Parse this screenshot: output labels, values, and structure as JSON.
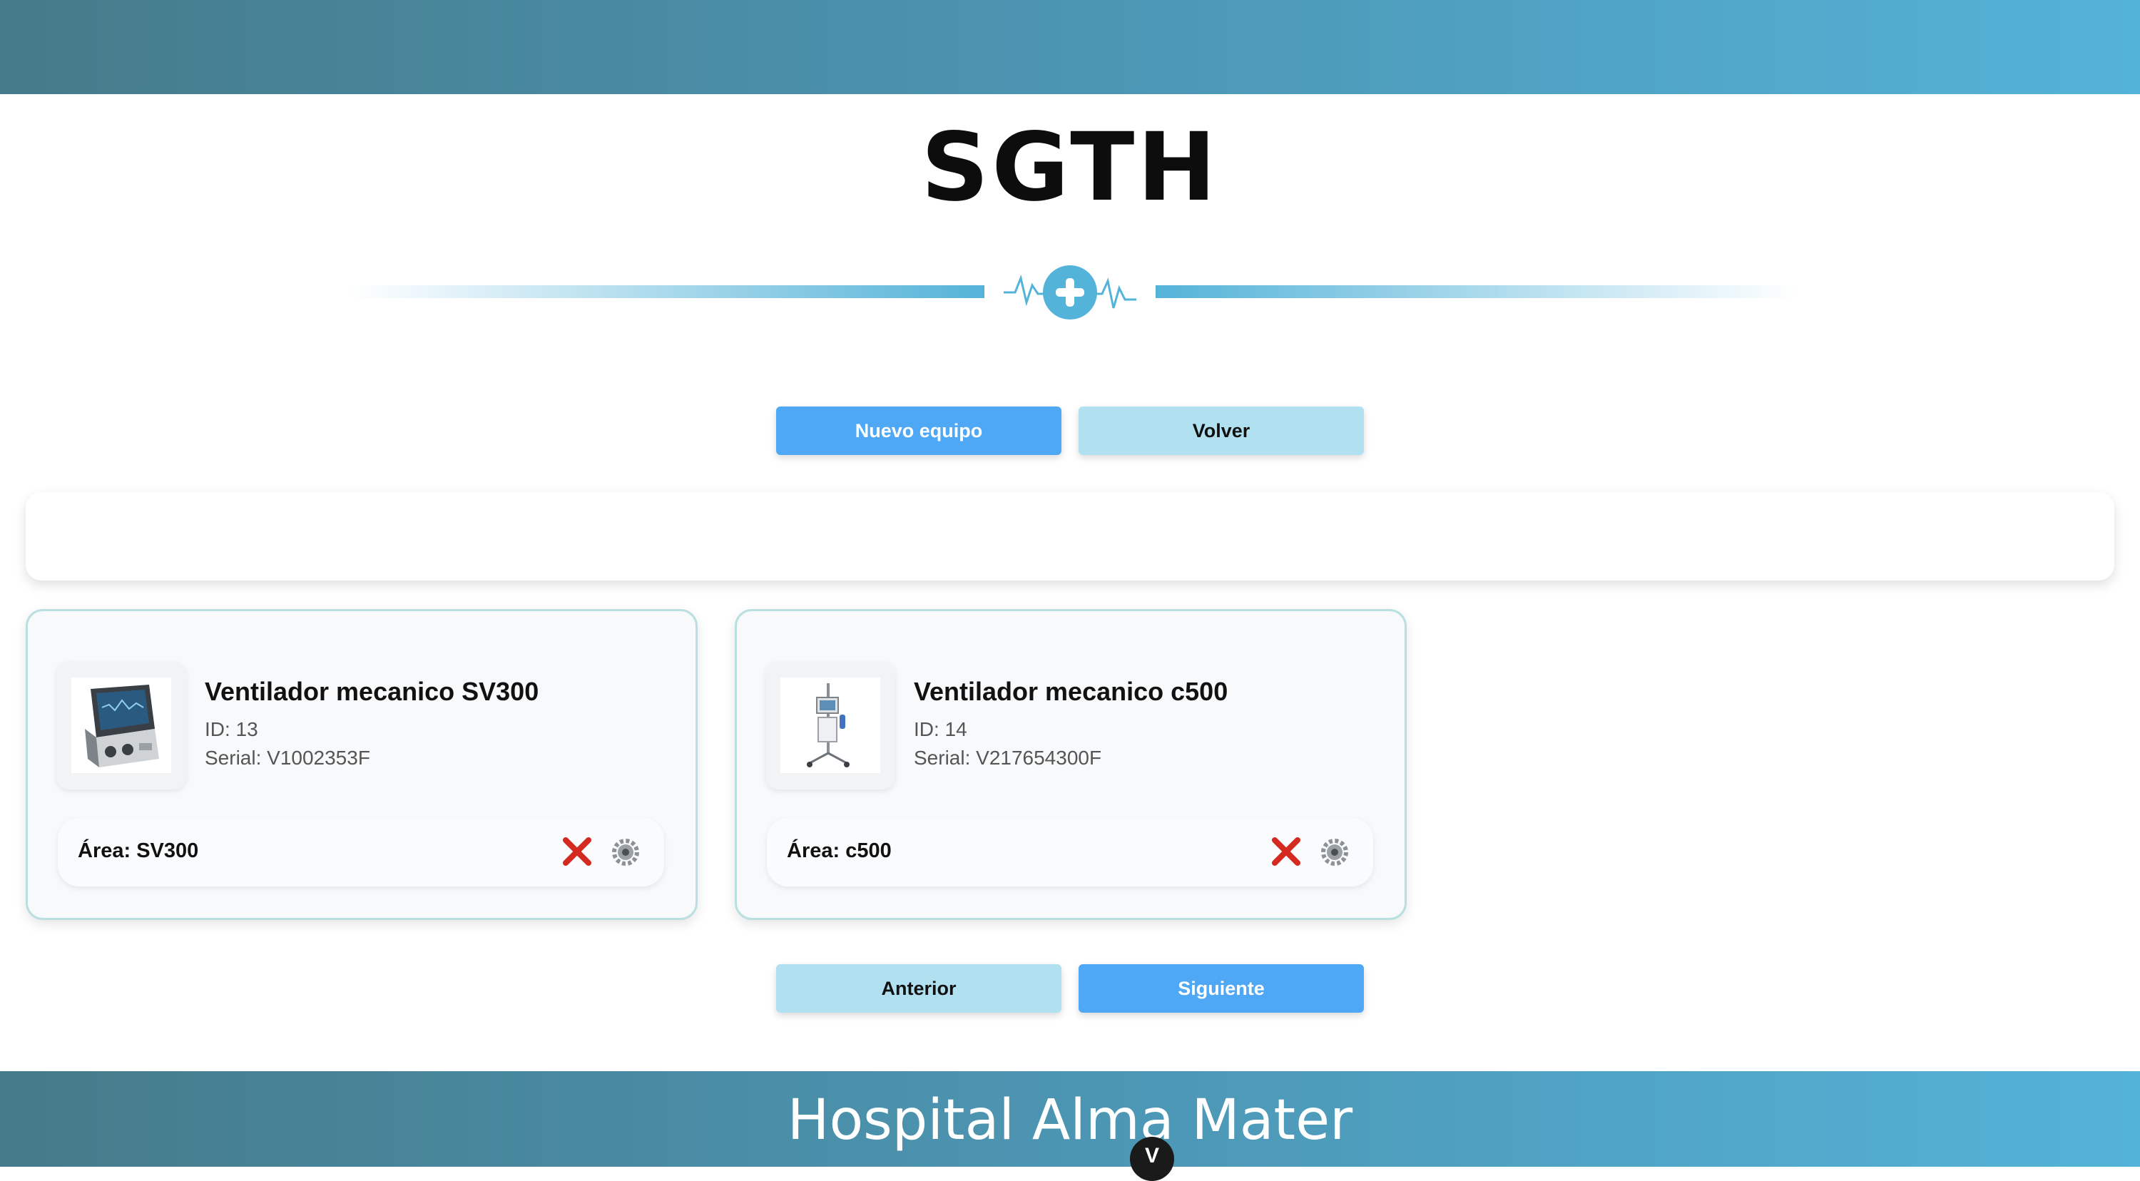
{
  "header": {
    "app_title": "SGTH"
  },
  "toolbar": {
    "new_label": "Nuevo equipo",
    "back_label": "Volver"
  },
  "equipment": [
    {
      "name": "Ventilador mecanico SV300",
      "id": "ID: 13",
      "serial": "Serial: V1002353F",
      "area": "Área: SV300"
    },
    {
      "name": "Ventilador mecanico c500",
      "id": "ID: 14",
      "serial": "Serial: V217654300F",
      "area": "Área: c500"
    }
  ],
  "pagination": {
    "prev_label": "Anterior",
    "next_label": "Siguiente"
  },
  "footer": {
    "hospital_name": "Hospital Alma Mater",
    "badge": "V"
  },
  "colors": {
    "header_gradient": [
      "#457b8a",
      "#54b3d8"
    ],
    "primary_button": "#4fa8f5",
    "secondary_button": "#b1e1f0",
    "delete": "#d42a1f",
    "accent": "#54b3d8"
  }
}
